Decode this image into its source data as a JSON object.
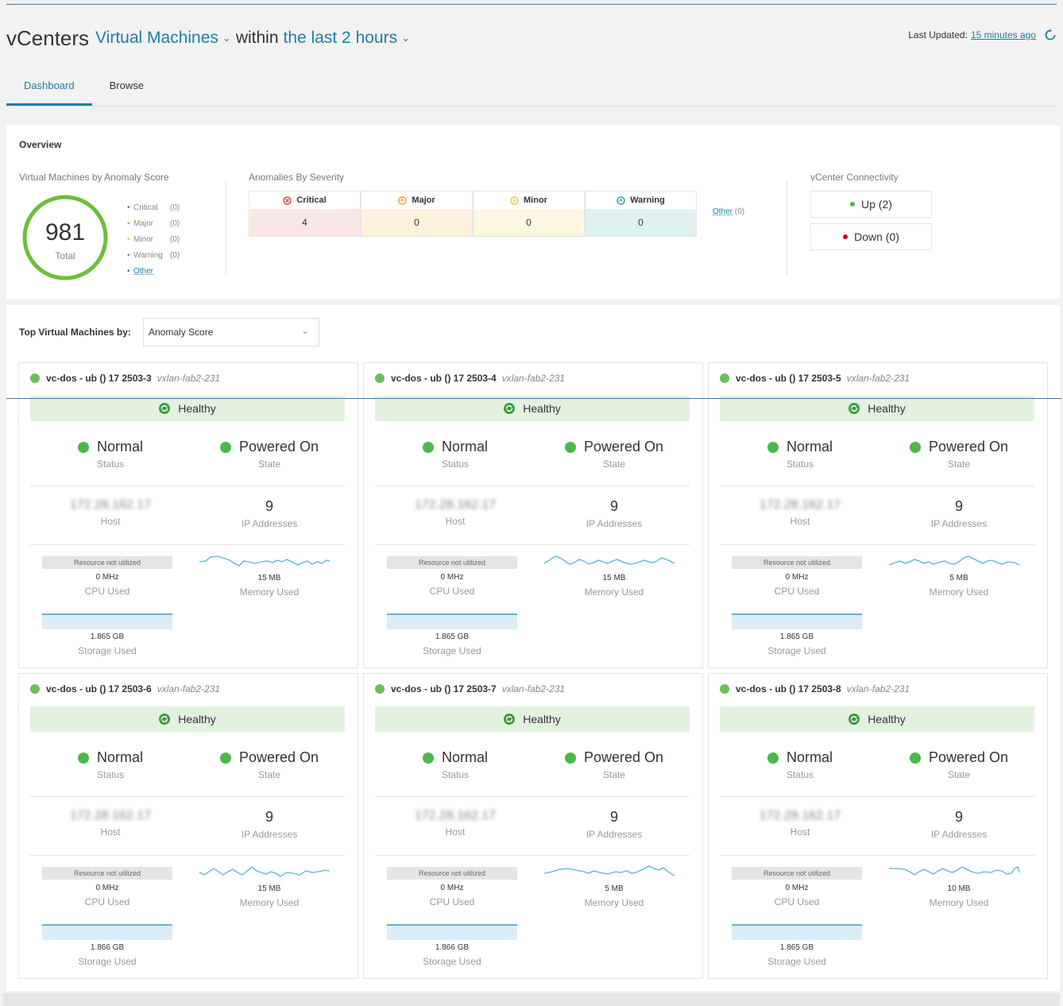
{
  "header": {
    "app": "vCenters",
    "entity": "Virtual Machines",
    "within": "within",
    "range": "the last 2 hours",
    "last_updated_label": "Last Updated:",
    "last_updated_value": "15 minutes ago"
  },
  "tabs": [
    {
      "label": "Dashboard",
      "active": true
    },
    {
      "label": "Browse",
      "active": false
    }
  ],
  "overview": {
    "title": "Overview",
    "anomaly_score": {
      "label": "Virtual Machines by Anomaly Score",
      "total": "981",
      "total_label": "Total",
      "legend": [
        {
          "label": "Critical",
          "count": "(0)",
          "color": "#e04848"
        },
        {
          "label": "Major",
          "count": "(0)",
          "color": "#f0a030"
        },
        {
          "label": "Minor",
          "count": "(0)",
          "color": "#f3c33a"
        },
        {
          "label": "Warning",
          "count": "(0)",
          "color": "#3aa0b0"
        }
      ],
      "other": "Other",
      "gauge_color": "#6bbf3a"
    },
    "severity": {
      "label": "Anomalies By Severity",
      "columns": [
        {
          "label": "Critical",
          "value": "4",
          "color": "#e04848",
          "bg": "#fbe6e6"
        },
        {
          "label": "Major",
          "value": "0",
          "color": "#f0a030",
          "bg": "#fdf0dd"
        },
        {
          "label": "Minor",
          "value": "0",
          "color": "#f3c33a",
          "bg": "#fdf6e0"
        },
        {
          "label": "Warning",
          "value": "0",
          "color": "#3aa0b0",
          "bg": "#e1f1f1"
        }
      ],
      "other": "Other",
      "other_count": "(0)"
    },
    "connectivity": {
      "label": "vCenter Connectivity",
      "up": "Up  (2)",
      "down": "Down  (0)",
      "up_color": "#4cb84c",
      "down_color": "#d0021b"
    }
  },
  "top_vms": {
    "label": "Top Virtual Machines by:",
    "selected": "Anomaly Score",
    "cards": [
      {
        "name": "vc-dos - ub () 17 2503-3",
        "fabric": "vxlan-fab2-231",
        "health": "Healthy",
        "status": "Normal",
        "status_cap": "Status",
        "state": "Powered On",
        "state_cap": "State",
        "host": "172.28.162.17",
        "host_cap": "Host",
        "ips": "9",
        "ips_cap": "IP Addresses",
        "cpu_note": "Resource not utilized",
        "cpu": "0 MHz",
        "cpu_cap": "CPU Used",
        "mem": "15 MB",
        "mem_cap": "Memory Used",
        "storage": "1.865 GB",
        "storage_cap": "Storage Used"
      },
      {
        "name": "vc-dos - ub () 17 2503-4",
        "fabric": "vxlan-fab2-231",
        "health": "Healthy",
        "status": "Normal",
        "status_cap": "Status",
        "state": "Powered On",
        "state_cap": "State",
        "host": "172.28.162.17",
        "host_cap": "Host",
        "ips": "9",
        "ips_cap": "IP Addresses",
        "cpu_note": "Resource not utilized",
        "cpu": "0 MHz",
        "cpu_cap": "CPU Used",
        "mem": "15 MB",
        "mem_cap": "Memory Used",
        "storage": "1.865 GB",
        "storage_cap": "Storage Used"
      },
      {
        "name": "vc-dos - ub () 17 2503-5",
        "fabric": "vxlan-fab2-231",
        "health": "Healthy",
        "status": "Normal",
        "status_cap": "Status",
        "state": "Powered On",
        "state_cap": "State",
        "host": "172.28.162.17",
        "host_cap": "Host",
        "ips": "9",
        "ips_cap": "IP Addresses",
        "cpu_note": "Resource not utilized",
        "cpu": "0 MHz",
        "cpu_cap": "CPU Used",
        "mem": "5 MB",
        "mem_cap": "Memory Used",
        "storage": "1.865 GB",
        "storage_cap": "Storage Used"
      },
      {
        "name": "vc-dos - ub () 17 2503-6",
        "fabric": "vxlan-fab2-231",
        "health": "Healthy",
        "status": "Normal",
        "status_cap": "Status",
        "state": "Powered On",
        "state_cap": "State",
        "host": "172.28.162.17",
        "host_cap": "Host",
        "ips": "9",
        "ips_cap": "IP Addresses",
        "cpu_note": "Resource not utilized",
        "cpu": "0 MHz",
        "cpu_cap": "CPU Used",
        "mem": "15 MB",
        "mem_cap": "Memory Used",
        "storage": "1.866 GB",
        "storage_cap": "Storage Used"
      },
      {
        "name": "vc-dos - ub () 17 2503-7",
        "fabric": "vxlan-fab2-231",
        "health": "Healthy",
        "status": "Normal",
        "status_cap": "Status",
        "state": "Powered On",
        "state_cap": "State",
        "host": "172.28.162.17",
        "host_cap": "Host",
        "ips": "9",
        "ips_cap": "IP Addresses",
        "cpu_note": "Resource not utilized",
        "cpu": "0 MHz",
        "cpu_cap": "CPU Used",
        "mem": "5 MB",
        "mem_cap": "Memory Used",
        "storage": "1.866 GB",
        "storage_cap": "Storage Used"
      },
      {
        "name": "vc-dos - ub () 17 2503-8",
        "fabric": "vxlan-fab2-231",
        "health": "Healthy",
        "status": "Normal",
        "status_cap": "Status",
        "state": "Powered On",
        "state_cap": "State",
        "host": "172.28.162.17",
        "host_cap": "Host",
        "ips": "9",
        "ips_cap": "IP Addresses",
        "cpu_note": "Resource not utilized",
        "cpu": "0 MHz",
        "cpu_cap": "CPU Used",
        "mem": "10 MB",
        "mem_cap": "Memory Used",
        "storage": "1.865 GB",
        "storage_cap": "Storage Used"
      }
    ]
  },
  "colors": {
    "accent": "#1b7fa6",
    "healthy_bg": "#e3f2df",
    "ok_green": "#4cb84c",
    "sparkline": "#5bb3d8"
  }
}
